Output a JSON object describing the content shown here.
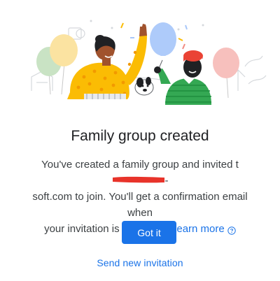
{
  "dialog": {
    "title": "Family group created",
    "message": {
      "line1_prefix": "You've created a family group and invited t",
      "line1_suffix": "-",
      "line2": "soft.com to join. You'll get a confirmation email when",
      "line3_prefix": "your invitation is accepted.",
      "learn_more": "Learn more"
    },
    "primary_button": "Got it",
    "secondary_link": "Send new invitation"
  },
  "icons": {
    "help": "help-circle-icon"
  },
  "colors": {
    "accent": "#1a73e8",
    "redaction": "#e8332a",
    "title_text": "#202124",
    "body_text": "#3c4043"
  }
}
